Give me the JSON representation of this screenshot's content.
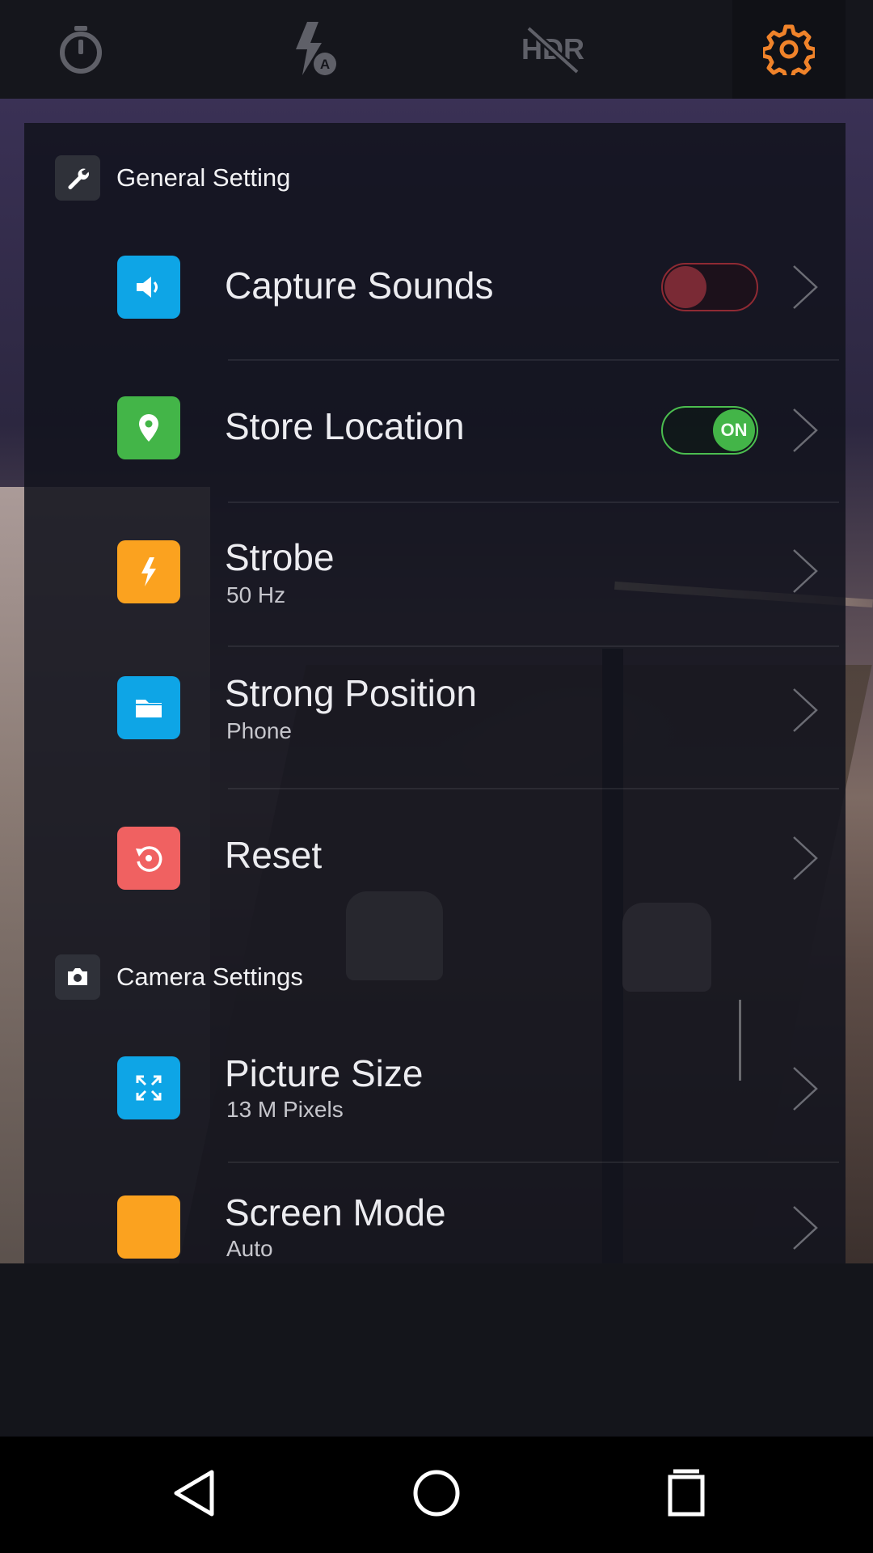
{
  "toolbar": {
    "items": [
      {
        "name": "timer",
        "icon": "stopwatch-icon",
        "active": false
      },
      {
        "name": "flash",
        "icon": "flash-auto-icon",
        "active": false
      },
      {
        "name": "hdr",
        "icon": "hdr-off-icon",
        "label": "HDR",
        "active": false
      },
      {
        "name": "settings",
        "icon": "gear-icon",
        "active": true
      }
    ],
    "colors": {
      "inactive": "#5f6068",
      "active": "#f0832a"
    }
  },
  "general": {
    "title": "General Setting",
    "icon": "wrench-icon",
    "items": [
      {
        "label": "Capture Sounds",
        "icon": "speaker-icon",
        "color": "#0ea5e6",
        "toggle": "off"
      },
      {
        "label": "Store Location",
        "icon": "location-pin-icon",
        "color": "#43b548",
        "toggle": "on",
        "toggle_text": "ON"
      },
      {
        "label": "Strobe",
        "sub": "50 Hz",
        "icon": "lightning-icon",
        "color": "#fba21f"
      },
      {
        "label": "Strong Position",
        "sub": "Phone",
        "icon": "folder-icon",
        "color": "#0ea5e6"
      },
      {
        "label": "Reset",
        "icon": "reset-icon",
        "color": "#f06161"
      }
    ]
  },
  "camera": {
    "title": "Camera Settings",
    "icon": "camera-icon",
    "items": [
      {
        "label": "Picture Size",
        "sub": "13 M Pixels",
        "icon": "expand-icon",
        "color": "#0ea5e6"
      },
      {
        "label": "Screen Mode",
        "sub": "Auto",
        "icon": "screen-mode-icon",
        "color": "#fba21f"
      }
    ]
  },
  "navbar": {
    "items": [
      {
        "name": "back",
        "icon": "back-triangle-icon"
      },
      {
        "name": "home",
        "icon": "home-circle-icon"
      },
      {
        "name": "recents",
        "icon": "recents-square-icon"
      }
    ]
  }
}
